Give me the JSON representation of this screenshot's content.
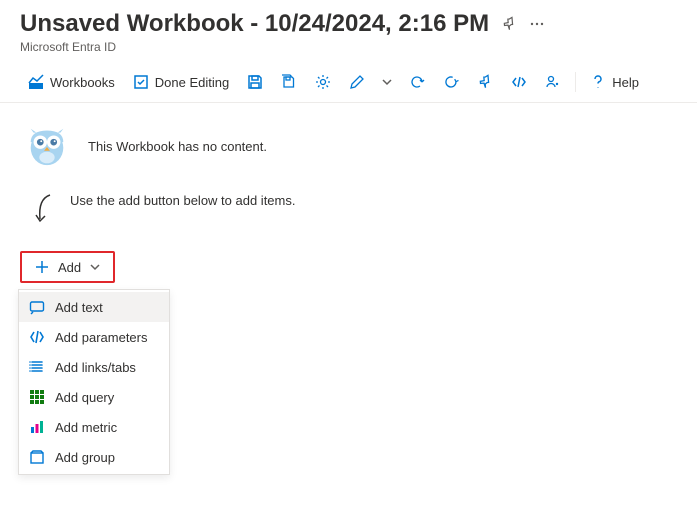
{
  "header": {
    "title": "Unsaved Workbook - 10/24/2024, 2:16 PM",
    "subtitle": "Microsoft Entra ID"
  },
  "toolbar": {
    "workbooks": "Workbooks",
    "done_editing": "Done Editing",
    "help": "Help"
  },
  "empty": {
    "message": "This Workbook has no content.",
    "hint": "Use the add button below to add items."
  },
  "add_button": {
    "label": "Add"
  },
  "add_menu": {
    "items": [
      {
        "label": "Add text"
      },
      {
        "label": "Add parameters"
      },
      {
        "label": "Add links/tabs"
      },
      {
        "label": "Add query"
      },
      {
        "label": "Add metric"
      },
      {
        "label": "Add group"
      }
    ]
  }
}
